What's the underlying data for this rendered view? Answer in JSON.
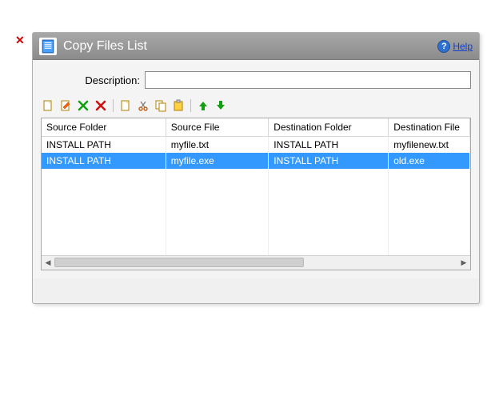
{
  "window": {
    "title": "Copy Files List",
    "help_label": "Help"
  },
  "form": {
    "description_label": "Description:",
    "description_value": ""
  },
  "toolbar": {
    "new": "New",
    "edit": "Edit",
    "delete": "Delete",
    "delete_all": "Delete All",
    "copy_doc": "Copy",
    "cut": "Cut",
    "duplicate": "Duplicate",
    "paste": "Paste",
    "move_up": "Move Up",
    "move_down": "Move Down"
  },
  "grid": {
    "columns": [
      "Source Folder",
      "Source File",
      "Destination Folder",
      "Destination File"
    ],
    "rows": [
      {
        "cells": [
          "INSTALL PATH",
          "myfile.txt",
          "INSTALL PATH",
          "myfilenew.txt"
        ],
        "selected": false
      },
      {
        "cells": [
          "INSTALL PATH",
          "myfile.exe",
          "INSTALL PATH",
          "old.exe"
        ],
        "selected": true
      }
    ],
    "empty_rows": 6
  }
}
